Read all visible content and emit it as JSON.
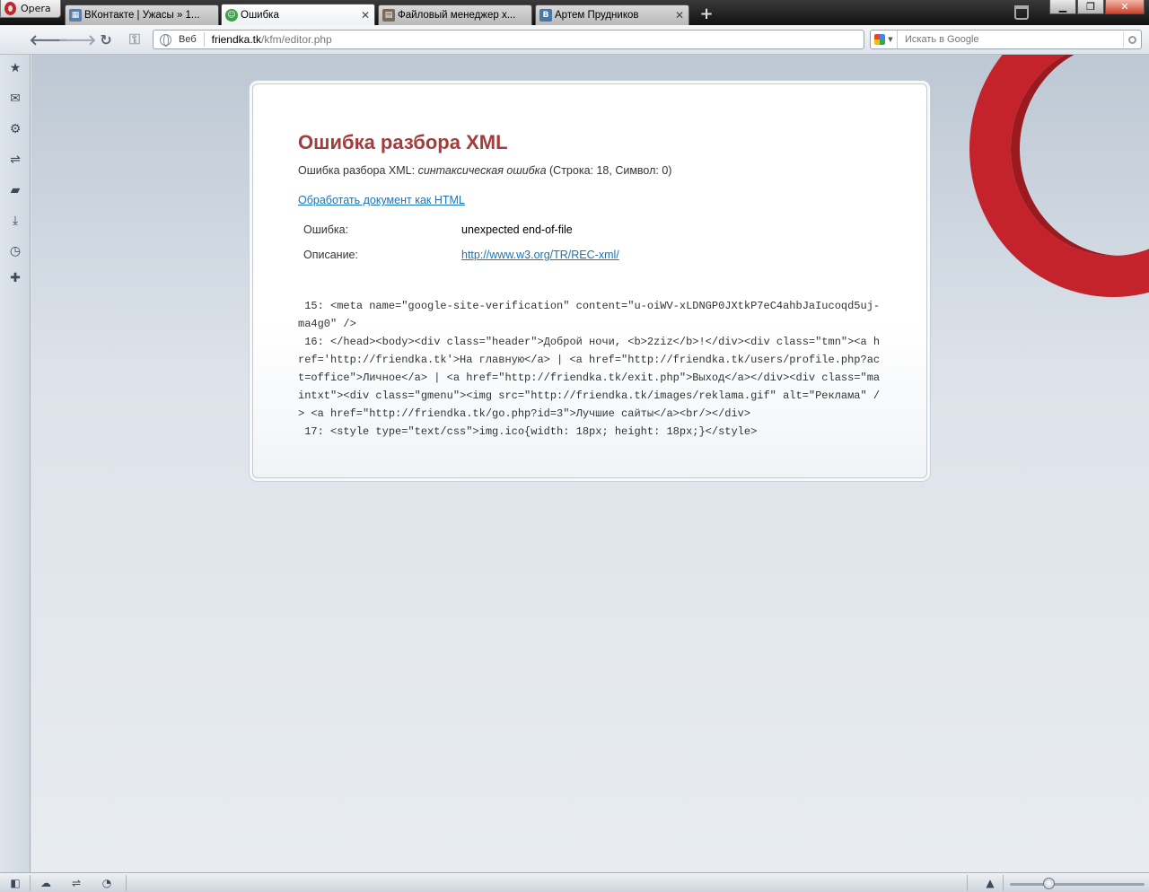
{
  "browser": {
    "menu_label": "Opera",
    "tabs": [
      {
        "label": "ВКонтакте | Ужасы » 1...",
        "active": false
      },
      {
        "label": "Ошибка",
        "active": true
      },
      {
        "label": "Файловый менеджер х...",
        "active": false
      },
      {
        "label": "Артем Прудников",
        "active": false
      }
    ],
    "new_tab": "+",
    "window_buttons": {
      "minimize": "▁",
      "restore": "❐",
      "close": "✕"
    }
  },
  "address_bar": {
    "zone_label": "Веб",
    "url_host": "friendka.tk",
    "url_path": "/kfm/editor.php"
  },
  "search": {
    "placeholder": "Искать в Google"
  },
  "error_page": {
    "title": "Ошибка разбора XML",
    "summary_prefix": "Ошибка разбора XML: ",
    "summary_italic": "синтаксическая ошибка",
    "summary_suffix": " (Строка: 18, Символ: 0)",
    "reparse_link": "Обработать документ как HTML",
    "error_label": "Ошибка:",
    "error_value": "unexpected end-of-file",
    "desc_label": "Описание:",
    "desc_value": "http://www.w3.org/TR/REC-xml/",
    "code_lines": [
      " 15: <meta name=\"google-site-verification\" content=\"u-oiWV-xLDNGP0JXtkP7eC4ahbJaIucoqd5uj-ma4g0\" />",
      " 16: </head><body><div class=\"header\">Доброй ночи, <b>2ziz</b>!</div><div class=\"tmn\"><a href='http://friendka.tk'>На главную</a> | <a href=\"http://friendka.tk/users/profile.php?act=office\">Личное</a> | <a href=\"http://friendka.tk/exit.php\">Выход</a></div><div class=\"maintxt\"><div class=\"gmenu\"><img src=\"http://friendka.tk/images/reklama.gif\" alt=\"Реклама\" /> <a href=\"http://friendka.tk/go.php?id=3\">Лучшие сайты</a><br/></div>",
      " 17: <style type=\"text/css\">img.ico{width: 18px; height: 18px;}</style>"
    ]
  },
  "colors": {
    "error_title": "#a43c3c",
    "link": "#1776b9",
    "opera_red": "#c5232b"
  }
}
